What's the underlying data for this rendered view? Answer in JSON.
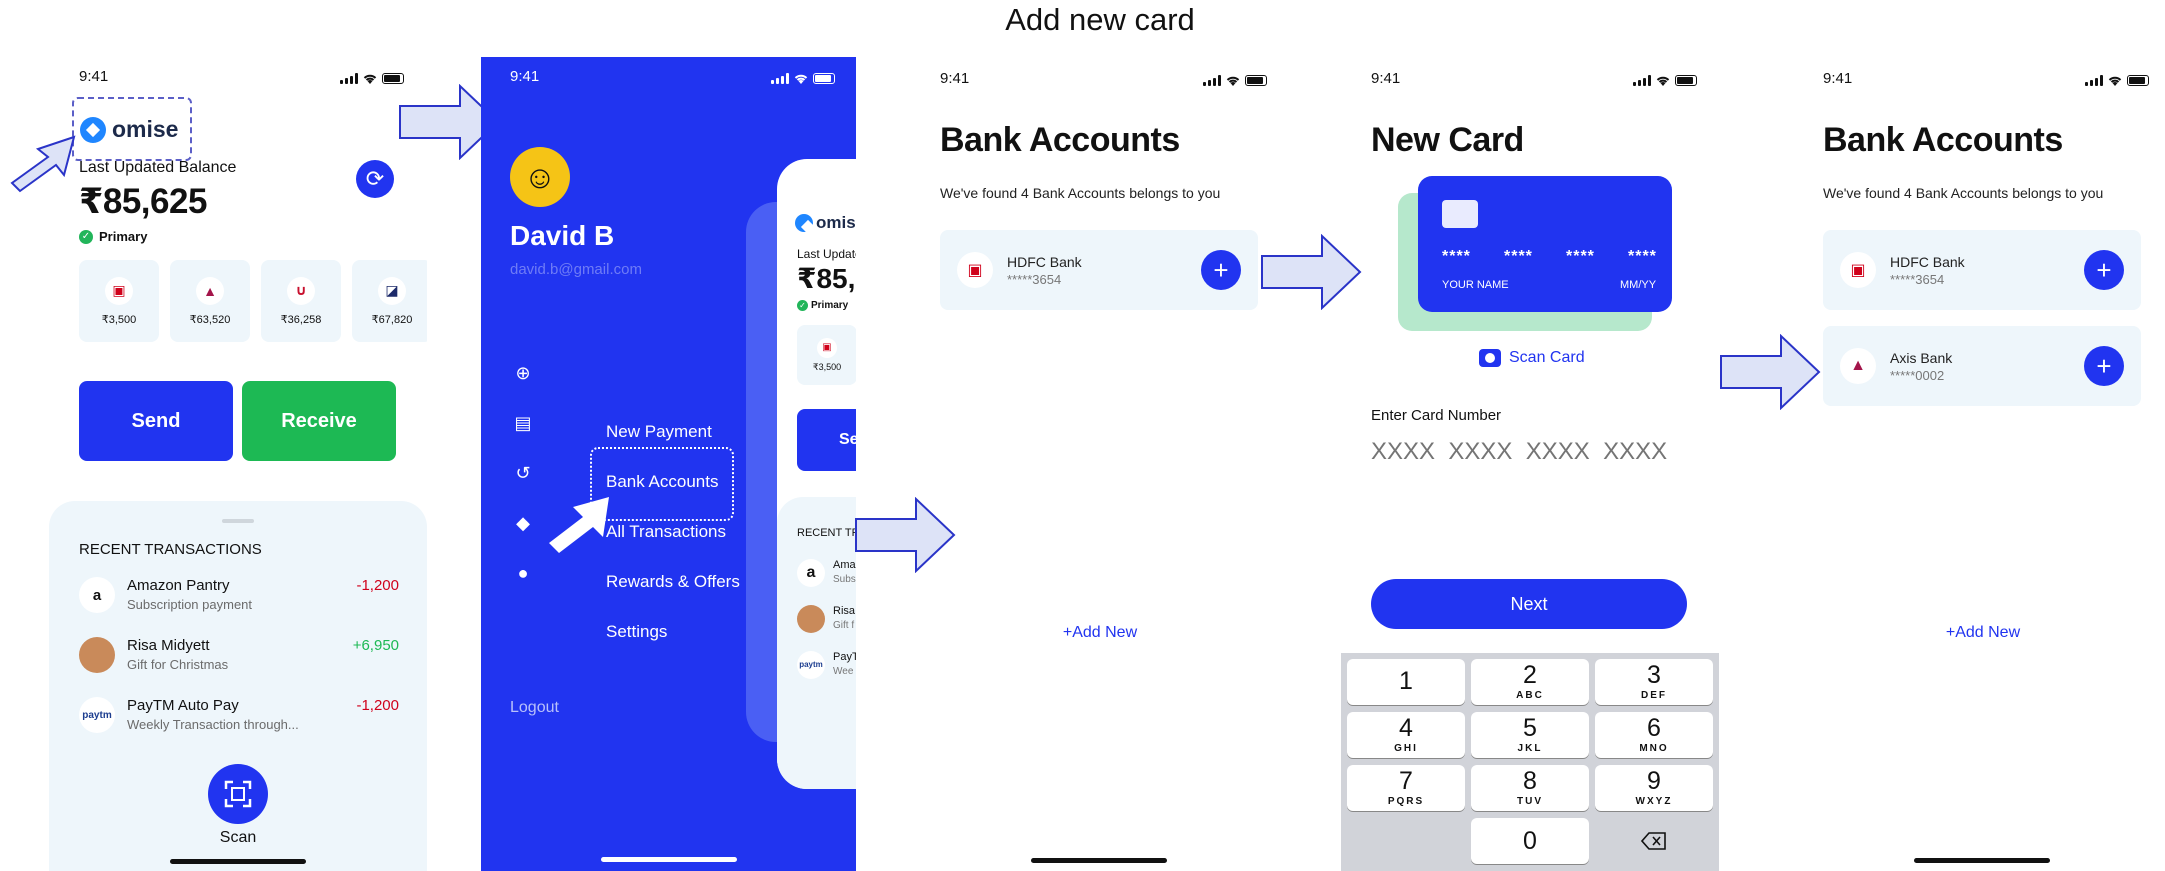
{
  "page_title": "Add new card",
  "status_time": "9:41",
  "screen1": {
    "brand": "omise",
    "balance_label": "Last Updated Balance",
    "balance": "₹85,625",
    "primary": "Primary",
    "banks": [
      {
        "icon": "hdfc-icon",
        "amount": "₹3,500"
      },
      {
        "icon": "axis-icon",
        "amount": "₹63,520"
      },
      {
        "icon": "union-icon",
        "amount": "₹36,258"
      },
      {
        "icon": "kotak-icon",
        "amount": "₹67,820"
      }
    ],
    "send": "Send",
    "receive": "Receive",
    "recent_header": "RECENT TRANSACTIONS",
    "transactions": [
      {
        "name": "Amazon Pantry",
        "sub": "Subscription payment",
        "amount": "-1,200",
        "color": "#d0021b"
      },
      {
        "name": "Risa Midyett",
        "sub": "Gift for Christmas",
        "amount": "+6,950",
        "color": "#1db954"
      },
      {
        "name": "PayTM Auto Pay",
        "sub": "Weekly Transaction through...",
        "amount": "-1,200",
        "color": "#d0021b"
      }
    ],
    "scan": "Scan"
  },
  "screen2": {
    "name": "David B",
    "email": "david.b@gmail.com",
    "menu": [
      "New Payment",
      "Bank Accounts",
      "All Transactions",
      "Rewards & Offers",
      "Settings"
    ],
    "logout": "Logout",
    "peek": {
      "brand": "omise",
      "balance_label": "Last Update",
      "balance": "₹85,",
      "primary": "Primary",
      "bank_amount": "₹3,500",
      "send": "Se",
      "recent": "RECENT TRA",
      "rows": [
        {
          "name": "Ama",
          "sub": "Subs"
        },
        {
          "name": "Risa",
          "sub": "Gift f"
        },
        {
          "name": "PayT",
          "sub": "Wee"
        }
      ]
    }
  },
  "screen3": {
    "title": "Bank Accounts",
    "subtitle": "We've found 4 Bank Accounts belongs to you",
    "accounts": [
      {
        "name": "HDFC Bank",
        "number": "*****3654"
      }
    ],
    "add_new": "+Add New"
  },
  "screen4": {
    "title": "New Card",
    "card_groups": [
      "****",
      "****",
      "****",
      "****"
    ],
    "card_name": "YOUR NAME",
    "card_exp": "MM/YY",
    "scan_card": "Scan Card",
    "enter_label": "Enter Card Number",
    "placeholder": "XXXX  XXXX  XXXX  XXXX",
    "next": "Next",
    "keys": [
      {
        "n": "1",
        "l": ""
      },
      {
        "n": "2",
        "l": "ABC"
      },
      {
        "n": "3",
        "l": "DEF"
      },
      {
        "n": "4",
        "l": "GHI"
      },
      {
        "n": "5",
        "l": "JKL"
      },
      {
        "n": "6",
        "l": "MNO"
      },
      {
        "n": "7",
        "l": "PQRS"
      },
      {
        "n": "8",
        "l": "TUV"
      },
      {
        "n": "9",
        "l": "WXYZ"
      },
      {
        "n": "0",
        "l": ""
      }
    ]
  },
  "screen5": {
    "title": "Bank Accounts",
    "subtitle": "We've found 4 Bank Accounts belongs to you",
    "accounts": [
      {
        "name": "HDFC Bank",
        "number": "*****3654"
      },
      {
        "name": "Axis Bank",
        "number": "*****0002"
      }
    ],
    "add_new": "+Add New"
  },
  "colors": {
    "primary": "#2134f0",
    "green": "#1db954",
    "panel": "#eef6fb",
    "debit": "#d0021b"
  }
}
